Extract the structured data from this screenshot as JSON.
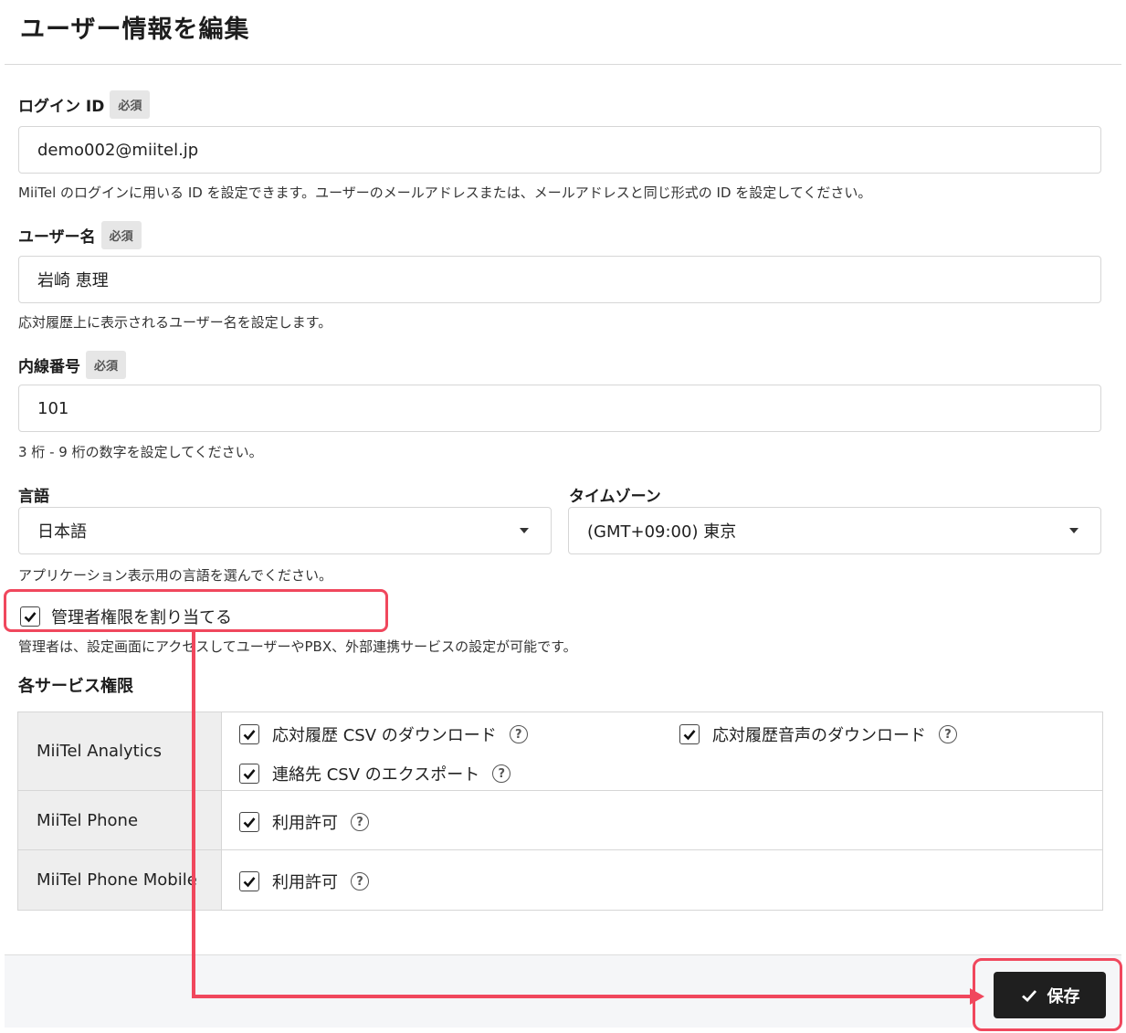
{
  "page": {
    "title": "ユーザー情報を編集"
  },
  "form": {
    "required_badge": "必須",
    "login_id": {
      "label": "ログイン ID",
      "value": "demo002@miitel.jp",
      "help": "MiiTel のログインに用いる ID を設定できます。ユーザーのメールアドレスまたは、メールアドレスと同じ形式の ID を設定してください。"
    },
    "user_name": {
      "label": "ユーザー名",
      "value": "岩崎 恵理",
      "help": "応対履歴上に表示されるユーザー名を設定します。"
    },
    "extension": {
      "label": "内線番号",
      "value": "101",
      "help": "3 桁 - 9 桁の数字を設定してください。"
    },
    "language": {
      "label": "言語",
      "value": "日本語",
      "help": "アプリケーション表示用の言語を選んでください。"
    },
    "timezone": {
      "label": "タイムゾーン",
      "value": "(GMT+09:00) 東京"
    },
    "admin": {
      "label": "管理者権限を割り当てる",
      "checked": true,
      "help": "管理者は、設定画面にアクセスしてユーザーやPBX、外部連携サービスの設定が可能です。"
    }
  },
  "services": {
    "section_title": "各サービス権限",
    "rows": [
      {
        "name": "MiiTel Analytics",
        "options": [
          {
            "label": "応対履歴 CSV のダウンロード",
            "checked": true
          },
          {
            "label": "応対履歴音声のダウンロード",
            "checked": true
          },
          {
            "label": "連絡先 CSV のエクスポート",
            "checked": true
          }
        ]
      },
      {
        "name": "MiiTel Phone",
        "options": [
          {
            "label": "利用許可",
            "checked": true
          }
        ]
      },
      {
        "name": "MiiTel Phone Mobile",
        "options": [
          {
            "label": "利用許可",
            "checked": true
          }
        ]
      }
    ],
    "help_glyph": "?"
  },
  "footer": {
    "save_label": "保存"
  },
  "colors": {
    "highlight": "#f0475d",
    "save_button": "#1f1f1f"
  }
}
